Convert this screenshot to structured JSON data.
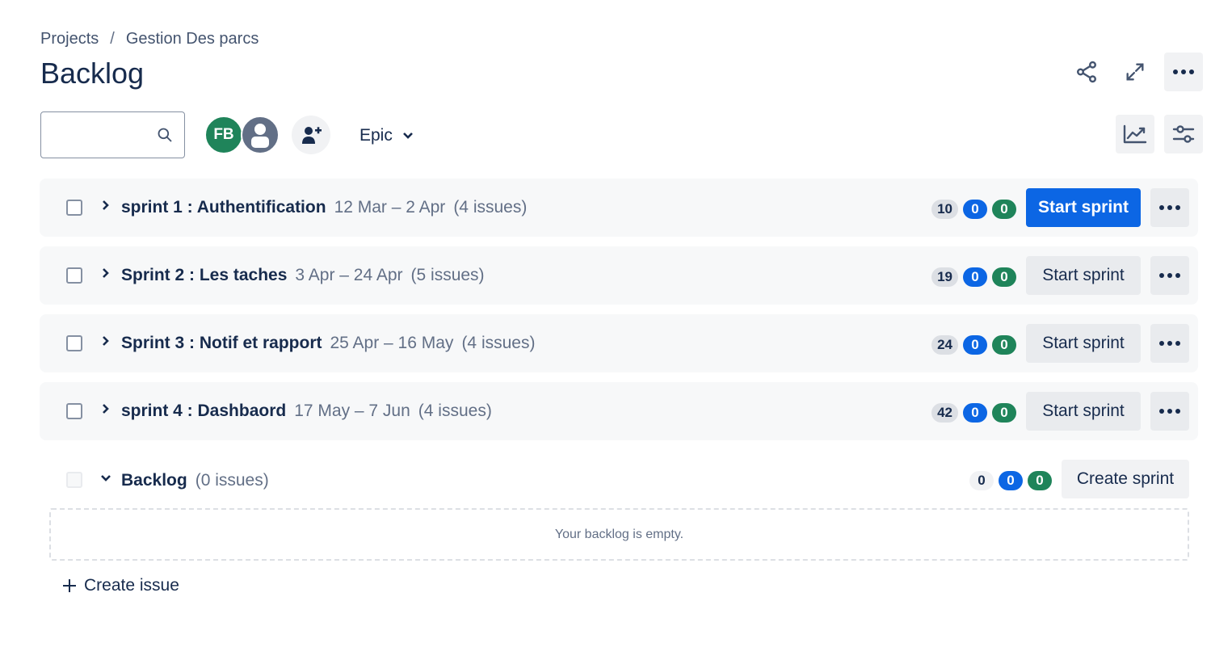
{
  "breadcrumb": {
    "projects": "Projects",
    "separator": "/",
    "project": "Gestion Des parcs"
  },
  "page": {
    "title": "Backlog"
  },
  "toolbar": {
    "search_placeholder": "",
    "avatar_initials": "FB",
    "epic_label": "Epic"
  },
  "sprints": [
    {
      "name": "sprint 1 : Authentification",
      "dates": "12 Mar – 2 Apr",
      "issues": "(4 issues)",
      "todo": "10",
      "in_progress": "0",
      "done": "0",
      "button": "Start sprint",
      "primary": true
    },
    {
      "name": "Sprint 2 : Les taches",
      "dates": "3 Apr – 24 Apr",
      "issues": "(5 issues)",
      "todo": "19",
      "in_progress": "0",
      "done": "0",
      "button": "Start sprint",
      "primary": false
    },
    {
      "name": "Sprint 3 : Notif et rapport",
      "dates": "25 Apr – 16 May",
      "issues": "(4 issues)",
      "todo": "24",
      "in_progress": "0",
      "done": "0",
      "button": "Start sprint",
      "primary": false
    },
    {
      "name": "sprint 4 : Dashbaord",
      "dates": "17 May – 7 Jun",
      "issues": "(4 issues)",
      "todo": "42",
      "in_progress": "0",
      "done": "0",
      "button": "Start sprint",
      "primary": false
    }
  ],
  "backlog": {
    "name": "Backlog",
    "issues": "(0 issues)",
    "todo": "0",
    "in_progress": "0",
    "done": "0",
    "create_sprint": "Create sprint",
    "empty_message": "Your backlog is empty."
  },
  "create_issue": "Create issue",
  "colors": {
    "primary": "#0c66e4",
    "success": "#1f845a",
    "text": "#172b4d",
    "subtle": "#626f86"
  },
  "icons": {
    "share": "share-icon",
    "fullscreen": "expand-icon",
    "more": "more-icon",
    "search": "search-icon",
    "add_person": "add-person-icon",
    "insights": "insights-icon",
    "settings": "view-settings-icon"
  }
}
